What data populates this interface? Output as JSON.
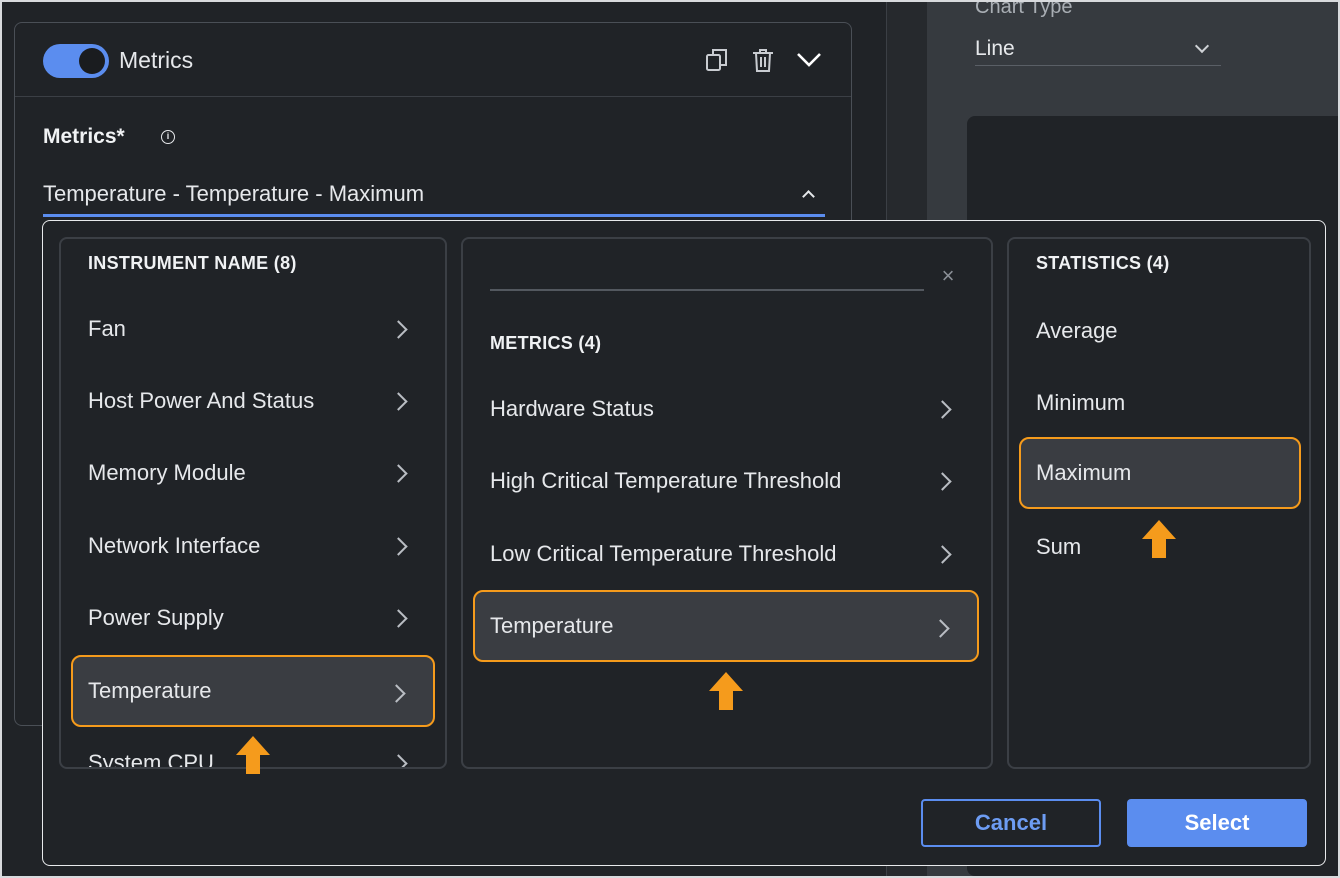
{
  "right_pane": {
    "chart_type_label": "Chart Type",
    "chart_type_value": "Line"
  },
  "panel": {
    "title": "Metrics",
    "toggle_on": true,
    "field_label": "Metrics*",
    "info_glyph": "i",
    "selected_value": "Temperature - Temperature - Maximum"
  },
  "picker": {
    "col1": {
      "heading": "INSTRUMENT NAME (8)",
      "items": [
        {
          "label": "Fan"
        },
        {
          "label": "Host Power And Status"
        },
        {
          "label": "Memory Module"
        },
        {
          "label": "Network Interface"
        },
        {
          "label": "Power Supply"
        },
        {
          "label": "Temperature"
        },
        {
          "label": "System CPU"
        }
      ]
    },
    "col2": {
      "search_value": "",
      "clear_glyph": "×",
      "heading": "METRICS (4)",
      "items": [
        {
          "label": "Hardware Status"
        },
        {
          "label": "High Critical Temperature Threshold"
        },
        {
          "label": "Low Critical Temperature Threshold"
        },
        {
          "label": "Temperature"
        }
      ]
    },
    "col3": {
      "heading": "STATISTICS (4)",
      "items": [
        {
          "label": "Average"
        },
        {
          "label": "Minimum"
        },
        {
          "label": "Maximum"
        },
        {
          "label": "Sum"
        }
      ]
    },
    "cancel_label": "Cancel",
    "select_label": "Select"
  },
  "colors": {
    "accent": "#5b8def",
    "highlight": "#f59b1c",
    "background": "#202327"
  }
}
